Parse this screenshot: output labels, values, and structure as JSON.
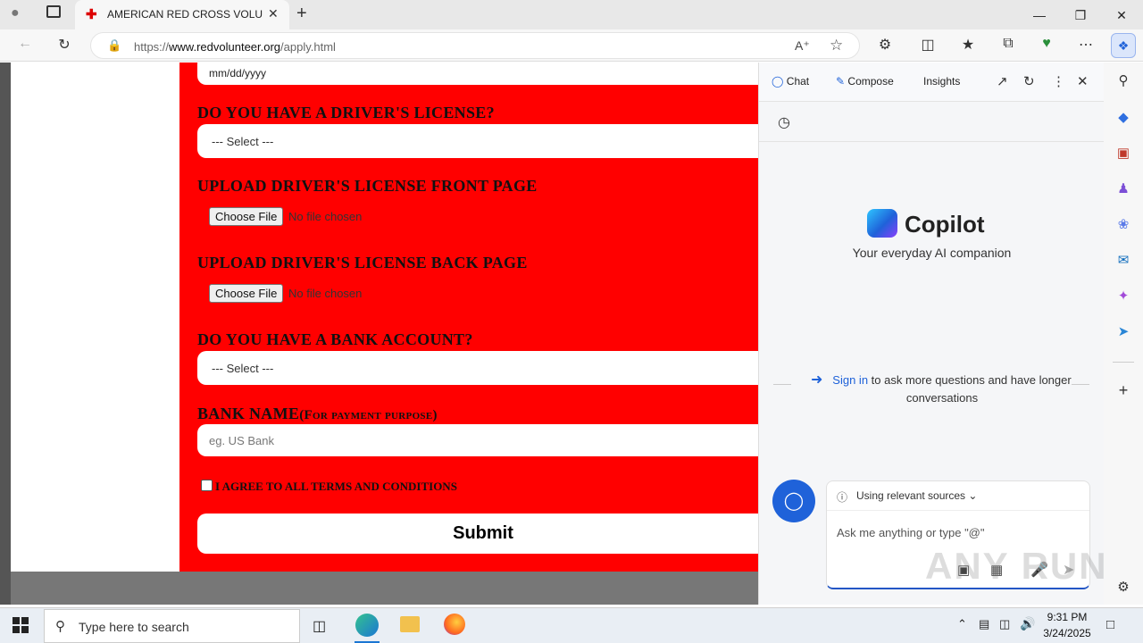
{
  "browser": {
    "tab_title": "AMERICAN RED CROSS VOLUNTI",
    "url_prefix": "https://",
    "url_domain": "www.redvolunteer.org",
    "url_path": "/apply.html"
  },
  "form": {
    "date_placeholder": "mm/dd/yyyy",
    "q_license": "DO YOU HAVE A DRIVER'S LICENSE?",
    "select_license": "--- Select ---",
    "q_front": "UPLOAD DRIVER'S LICENSE FRONT PAGE",
    "q_back": "UPLOAD DRIVER'S LICENSE BACK PAGE",
    "choose_file": "Choose File",
    "no_file": "No file chosen",
    "q_bank": "DO YOU HAVE A BANK ACCOUNT?",
    "select_bank": "--- Select ---",
    "q_bank_name": "BANK NAME",
    "q_bank_name_suffix": "(For payment purpose)",
    "bank_placeholder": "eg. US Bank",
    "agree_label": "I AGREE TO ALL TERMS AND CONDITIONS",
    "submit_label": "Submit"
  },
  "copilot": {
    "tabs": [
      "Chat",
      "Compose",
      "Insights"
    ],
    "title": "Copilot",
    "subtitle": "Your everyday AI companion",
    "sign_in_link": "Sign in",
    "sign_in_text": "to ask more questions and have longer conversations",
    "sources_label": "Using relevant sources",
    "input_placeholder": "Ask me anything or type \"@\""
  },
  "taskbar": {
    "search_placeholder": "Type here to search",
    "time": "9:31 PM",
    "date": "3/24/2025"
  },
  "watermark": "ANY RUN",
  "colors": {
    "form_bg": "#ff0000",
    "copilot_accent": "#1f62d9"
  }
}
